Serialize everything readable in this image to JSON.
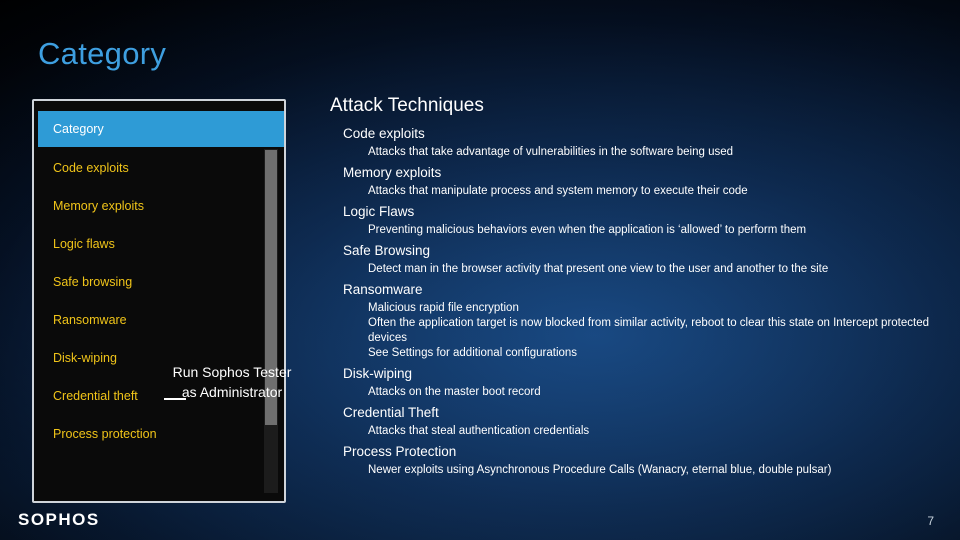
{
  "slide": {
    "title": "Category",
    "page_number": "7",
    "logo_text": "SOPHOS",
    "accent_color": "#3e9fe0",
    "highlight_color": "#2e9bd6",
    "list_text_color": "#f0c419"
  },
  "app_window": {
    "header_label": "Category",
    "items": [
      {
        "label": "Code exploits"
      },
      {
        "label": "Memory exploits"
      },
      {
        "label": "Logic flaws"
      },
      {
        "label": "Safe browsing"
      },
      {
        "label": "Ransomware"
      },
      {
        "label": "Disk-wiping"
      },
      {
        "label": "Credential theft"
      },
      {
        "label": "Process protection"
      }
    ]
  },
  "callout": {
    "text": "Run Sophos Tester as Administrator"
  },
  "content": {
    "title": "Attack Techniques",
    "sections": [
      {
        "category": "Code exploits",
        "descriptions": [
          "Attacks that take advantage of vulnerabilities in the software being used"
        ]
      },
      {
        "category": "Memory exploits",
        "descriptions": [
          "Attacks that manipulate process and system memory to execute their code"
        ]
      },
      {
        "category": "Logic Flaws",
        "descriptions": [
          "Preventing malicious behaviors even when the application is ‘allowed’ to perform them"
        ]
      },
      {
        "category": "Safe Browsing",
        "descriptions": [
          "Detect man in the browser activity that present one view to the user and another to the site"
        ]
      },
      {
        "category": "Ransomware",
        "descriptions": [
          "Malicious rapid file encryption",
          "Often the application target is now blocked from similar activity, reboot to clear this state on Intercept protected devices",
          "See Settings for additional configurations"
        ]
      },
      {
        "category": "Disk-wiping",
        "descriptions": [
          "Attacks on the master boot record"
        ]
      },
      {
        "category": "Credential Theft",
        "descriptions": [
          "Attacks that steal authentication credentials"
        ]
      },
      {
        "category": "Process Protection",
        "descriptions": [
          "Newer exploits using Asynchronous Procedure Calls (Wanacry, eternal blue, double pulsar)"
        ]
      }
    ]
  }
}
